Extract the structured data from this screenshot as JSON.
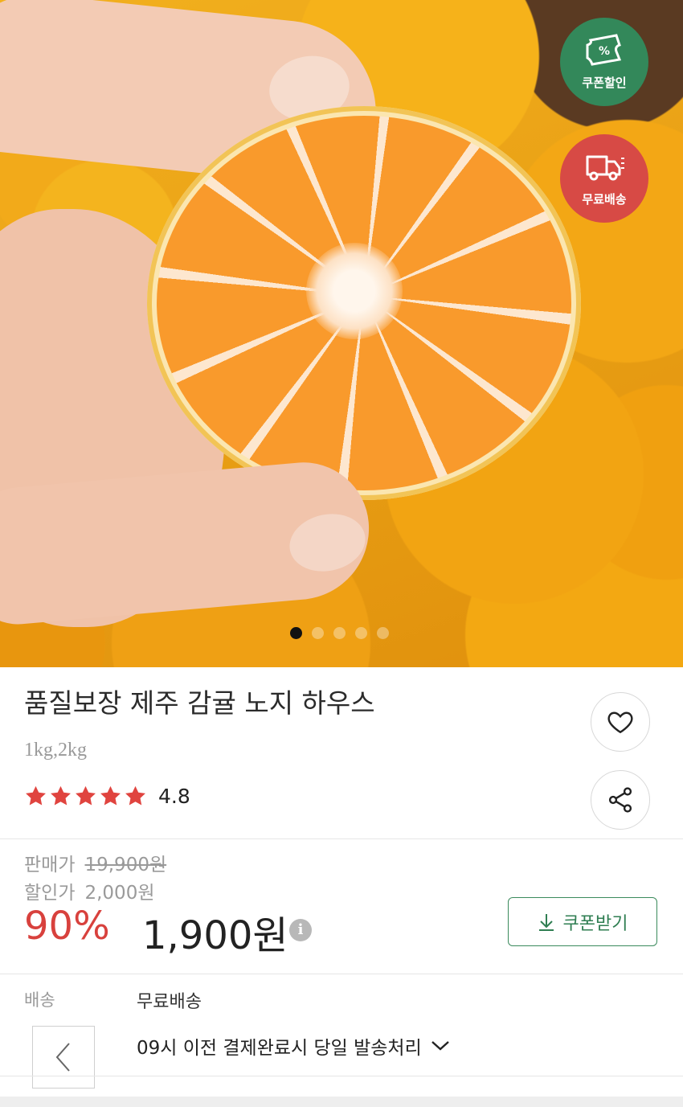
{
  "badges": {
    "coupon": {
      "symbol": "%",
      "label": "쿠폰할인",
      "color": "#33885a"
    },
    "shipping": {
      "label": "무료배송",
      "color": "#d74a45"
    }
  },
  "carousel": {
    "total": 5,
    "active_index": 0
  },
  "product": {
    "title": "품질보장 제주 감귤 노지 하우스",
    "options": "1kg,2kg",
    "rating": "4.8",
    "stars": 5
  },
  "pricing": {
    "sale_label": "판매가",
    "sale_value": "19,900원",
    "discount_label": "할인가",
    "discount_value": "2,000원",
    "discount_percent": "90%",
    "final_price": "1,900원",
    "info_symbol": "i",
    "coupon_button": "쿠폰받기",
    "accent_color": "#d8413d"
  },
  "shipping": {
    "label": "배송",
    "value": "무료배송",
    "note": "09시 이전 결제완료시 당일 발송처리"
  }
}
